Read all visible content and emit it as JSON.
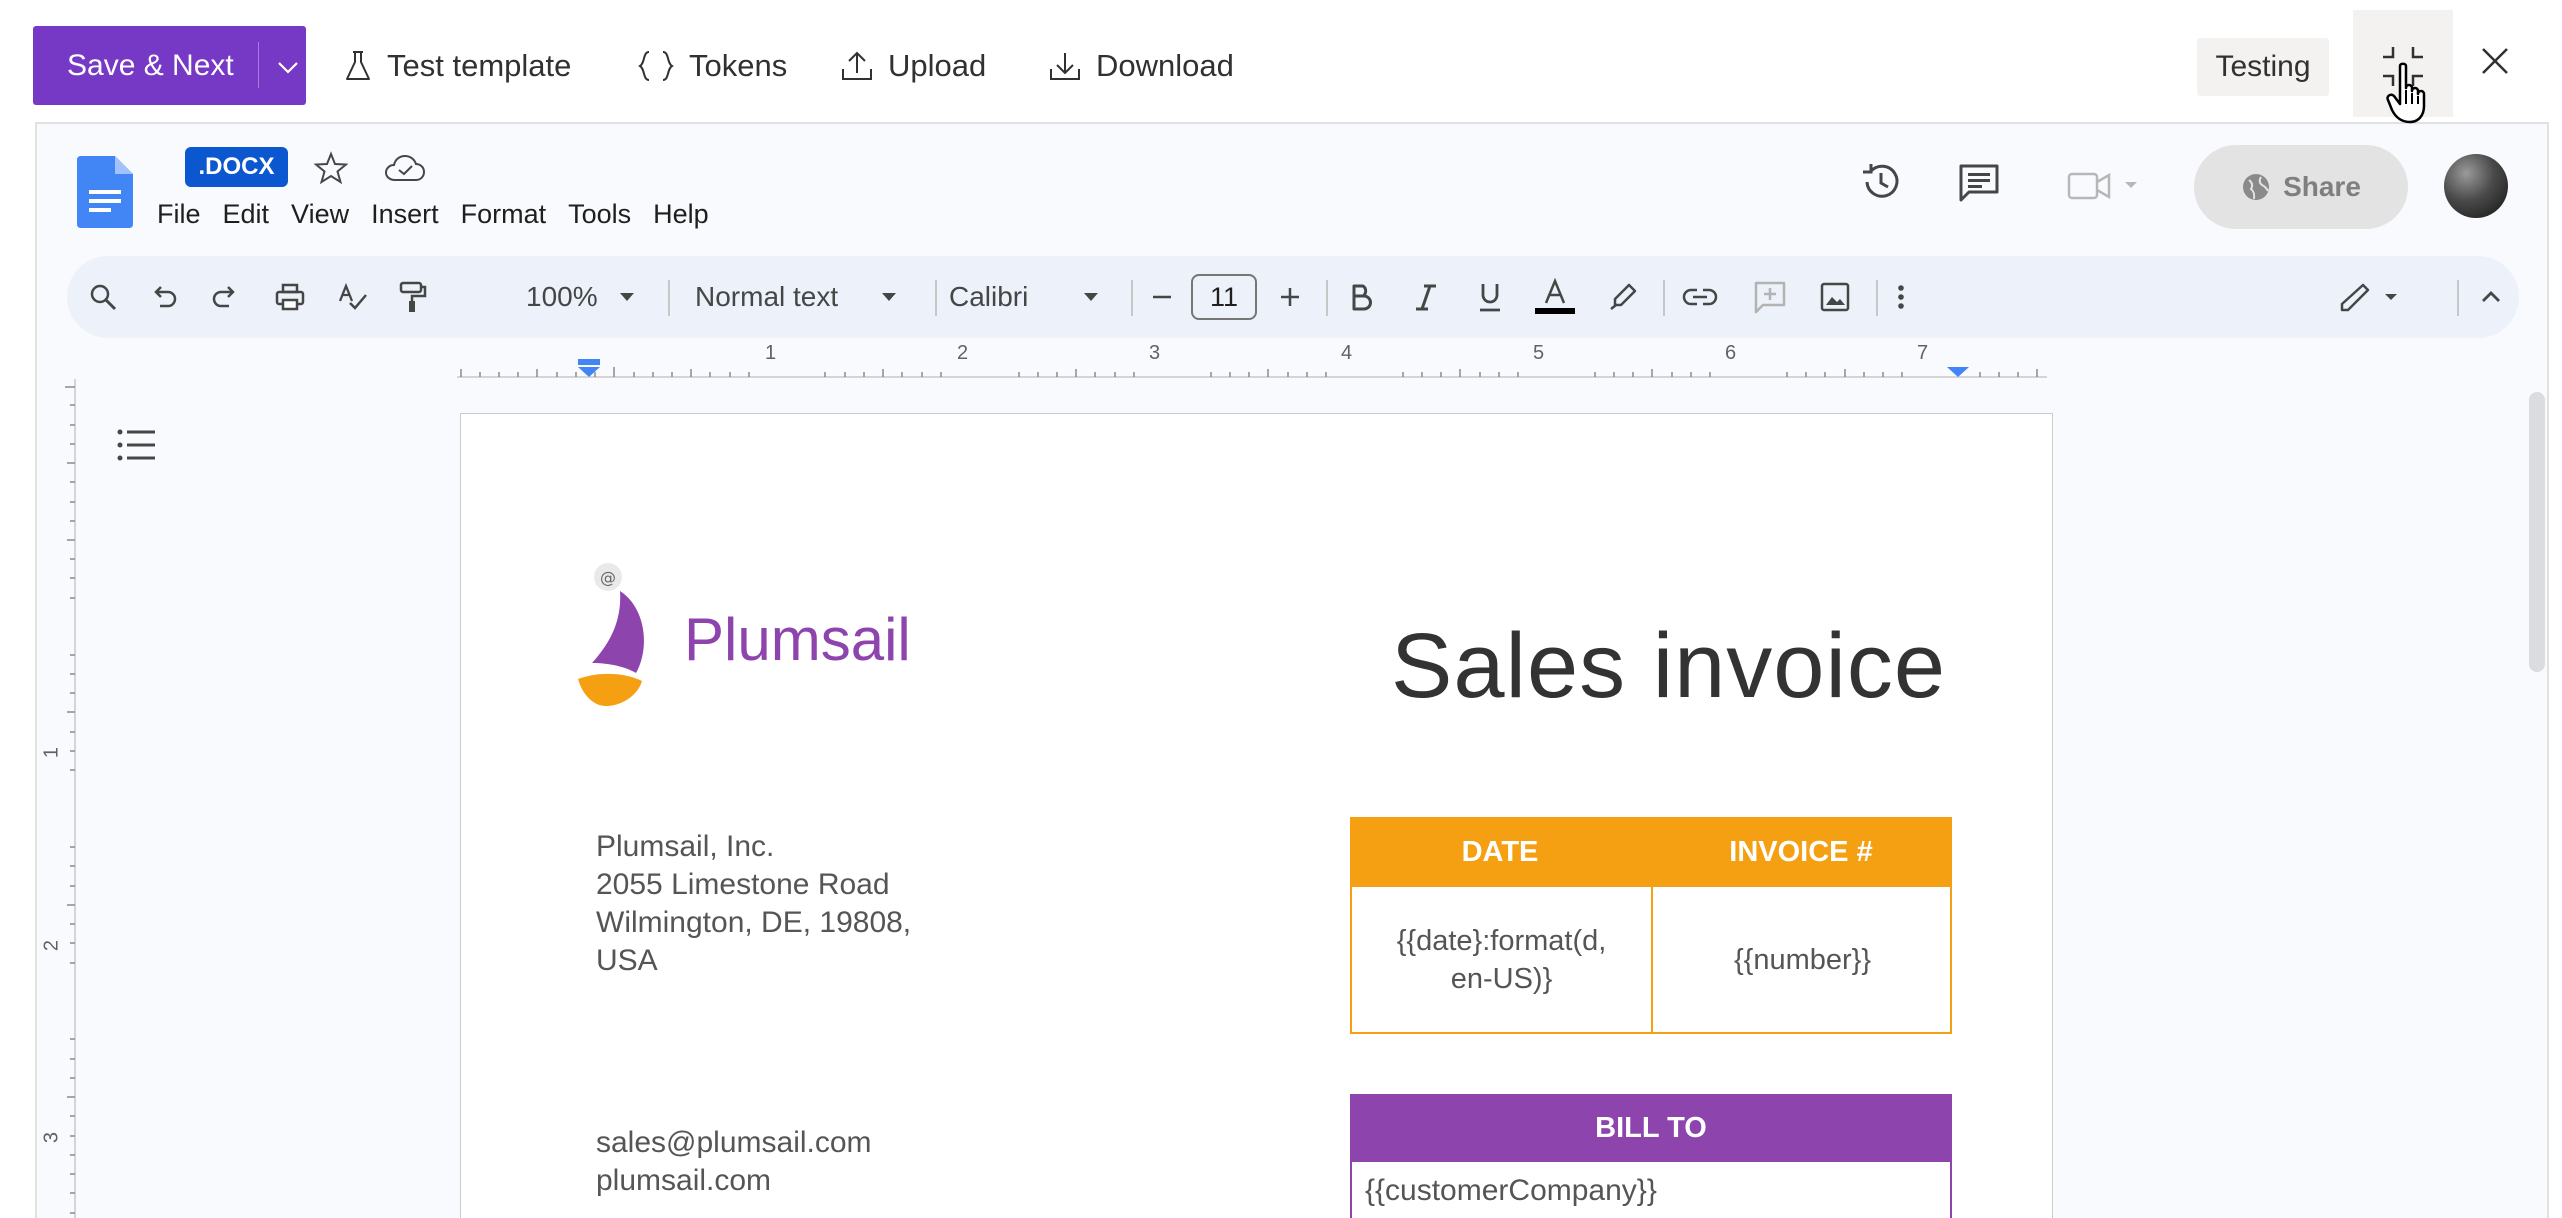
{
  "toolbar": {
    "save_next": "Save & Next",
    "test_template": "Test template",
    "tokens": "Tokens",
    "upload": "Upload",
    "download": "Download",
    "status_badge": "Testing",
    "accent_color": "#7639c6"
  },
  "docs": {
    "file_type_badge": ".DOCX",
    "menu": [
      "File",
      "Edit",
      "View",
      "Insert",
      "Format",
      "Tools",
      "Help"
    ],
    "share_label": "Share",
    "format_toolbar": {
      "zoom": "100%",
      "paragraph_style": "Normal text",
      "font": "Calibri",
      "font_size": "11"
    },
    "ruler_numbers": [
      "1",
      "2",
      "3",
      "4",
      "5",
      "6",
      "7"
    ],
    "vertical_ruler_numbers": [
      "1",
      "2",
      "3"
    ]
  },
  "invoice": {
    "logo_text": "Plumsail",
    "title": "Sales invoice",
    "address": [
      "Plumsail, Inc.",
      "2055 Limestone Road",
      "Wilmington, DE, 19808,",
      "USA"
    ],
    "contact": [
      "sales@plumsail.com",
      "plumsail.com"
    ],
    "date_header": "DATE",
    "invoice_header": "INVOICE #",
    "date_value_line1": "{{date}:format(d,",
    "date_value_line2": "en-US)}",
    "number_value": "{{number}}",
    "bill_to_header": "BILL TO",
    "customer_company": "{{customerCompany}}",
    "colors": {
      "orange": "#f5a012",
      "purple": "#8e44ad"
    }
  }
}
